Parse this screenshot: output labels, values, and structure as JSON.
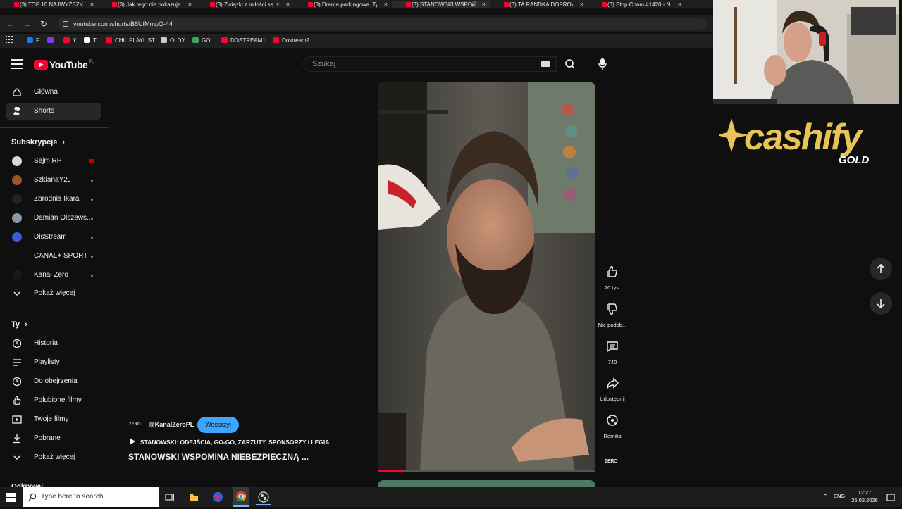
{
  "browser": {
    "tabs": [
      {
        "title": "(3) TOP 10 NAJWYŻSZYCH",
        "active": false
      },
      {
        "title": "(3) Jak tego nie pokazuje",
        "active": false
      },
      {
        "title": "(3) Związki z miłości są m",
        "active": false
      },
      {
        "title": "(3) Drama parkingowa. Ty",
        "active": false
      },
      {
        "title": "(3) STANOWSKI WSPO",
        "active": true
      },
      {
        "title": "(3) TA RANDKA DOPROW",
        "active": false
      },
      {
        "title": "(3) Stop Cham #1420 - N",
        "active": false
      }
    ],
    "url": "youtube.com/shorts/B8UfMmpQ-44",
    "bookmarks": [
      {
        "label": "F",
        "color": "#1877f2"
      },
      {
        "label": "",
        "color": "#7b3ff2"
      },
      {
        "label": "Y",
        "color": "#ff0033"
      },
      {
        "label": "T",
        "color": "#ffffff"
      },
      {
        "label": "CHIL PLAYLIST",
        "color": "#ff0033"
      },
      {
        "label": "OLDY",
        "color": "#cccccc"
      },
      {
        "label": "GOL",
        "color": "#3aa757"
      },
      {
        "label": "DOSTREAM1",
        "color": "#ff0033"
      },
      {
        "label": "Dostream2",
        "color": "#ff0033"
      }
    ]
  },
  "masthead": {
    "logo_text": "YouTube",
    "logo_region": "PL",
    "search_placeholder": "Szukaj"
  },
  "sidebar": {
    "main_items": [
      {
        "label": "Główna",
        "icon": "home-icon",
        "active": false
      },
      {
        "label": "Shorts",
        "icon": "shorts-icon",
        "active": true
      }
    ],
    "subscriptions_heading": "Subskrypcje",
    "subscriptions": [
      {
        "name": "Sejm RP",
        "avatar_color": "#d8d8d8",
        "indicator": "live"
      },
      {
        "name": "SzklanaY2J",
        "avatar_color": "#a0522d",
        "indicator": "new"
      },
      {
        "name": "Zbrodnia Ikara",
        "avatar_color": "#222222",
        "indicator": "new"
      },
      {
        "name": "Damian Olszews...",
        "avatar_color": "#8899aa",
        "indicator": "new"
      },
      {
        "name": "DisStream",
        "avatar_color": "#3b5bdb",
        "indicator": "new"
      },
      {
        "name": "CANAL+ SPORT",
        "avatar_color": "#111111",
        "indicator": "new"
      },
      {
        "name": "Kanał Zero",
        "avatar_color": "#1a1a1a",
        "indicator": "new"
      }
    ],
    "show_more_1": "Pokaż więcej",
    "you_heading": "Ty",
    "you_items": [
      {
        "label": "Historia",
        "icon": "history-icon"
      },
      {
        "label": "Playlisty",
        "icon": "playlists-icon"
      },
      {
        "label": "Do obejrzenia",
        "icon": "watch-later-icon"
      },
      {
        "label": "Polubione filmy",
        "icon": "liked-icon"
      },
      {
        "label": "Twoje filmy",
        "icon": "your-videos-icon"
      },
      {
        "label": "Pobrane",
        "icon": "download-icon"
      }
    ],
    "show_more_2": "Pokaż więcej",
    "cut_heading": "Odkrywaj"
  },
  "short": {
    "channel_logo": "ZERO",
    "channel_handle": "@KanalZeroPL",
    "support_label": "Wesprzyj",
    "playlist_title": "STANOWSKI: ODEJŚCIA, GO-GO, ZARZUTY, SPONSORZY I LEGIA",
    "title": "STANOWSKI WSPOMINA NIEBEZPIECZNĄ ...",
    "progress": 0.12,
    "watermark": "ZERO"
  },
  "actions": {
    "like_count": "20 tys.",
    "dislike_label": "Nie podob...",
    "comments_count": "740",
    "share_label": "Udostępnij",
    "remix_label": "Remiks"
  },
  "overlay": {
    "brand_name": "cashify",
    "brand_sub": "GOLD"
  },
  "taskbar": {
    "search_placeholder": "Type here to search",
    "language": "ENG",
    "time": "12:27",
    "date": "25.02.2026"
  }
}
